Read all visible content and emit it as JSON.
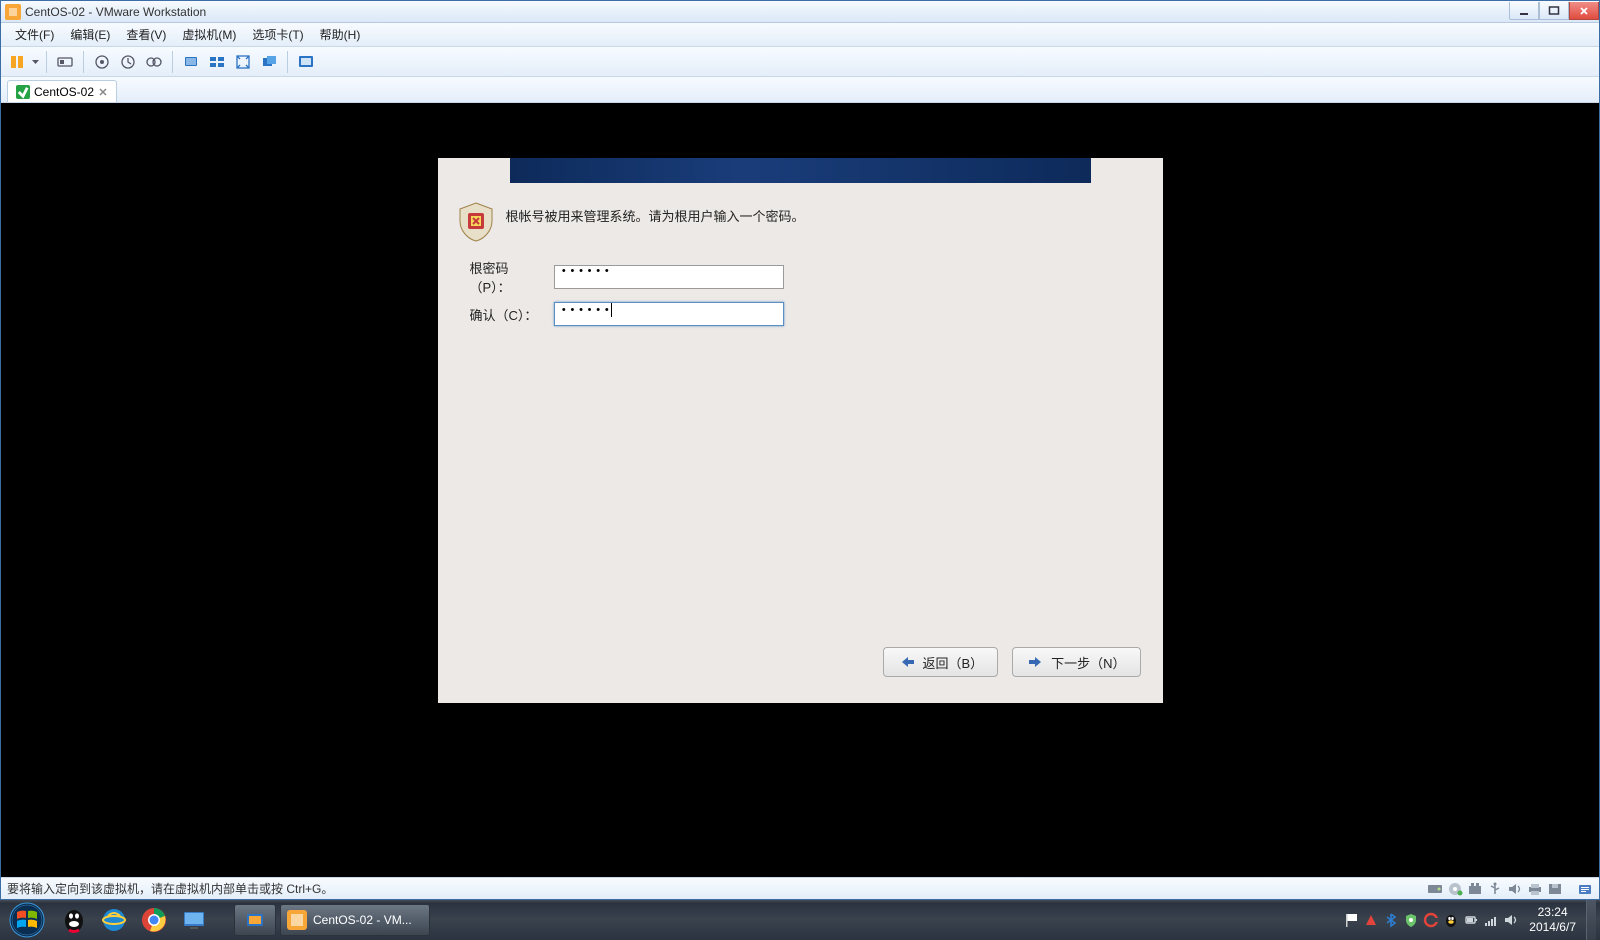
{
  "window": {
    "title": "CentOS-02 - VMware Workstation"
  },
  "menu": {
    "file": "文件(F)",
    "edit": "编辑(E)",
    "view": "查看(V)",
    "vm": "虚拟机(M)",
    "tabs": "选项卡(T)",
    "help": "帮助(H)"
  },
  "tab": {
    "label": "CentOS-02"
  },
  "installer": {
    "description": "根帐号被用来管理系统。请为根用户输入一个密码。",
    "password_label": "根密码（P）：",
    "password_value": "••••••",
    "confirm_label": "确认（C）：",
    "confirm_value": "••••••",
    "back_label": "返回（B）",
    "next_label": "下一步（N）"
  },
  "statusbar": {
    "hint": "要将输入定向到该虚拟机，请在虚拟机内部单击或按 Ctrl+G。"
  },
  "taskbar": {
    "running_app": "CentOS-02 - VM...",
    "clock_time": "23:24",
    "clock_date": "2014/6/7"
  }
}
